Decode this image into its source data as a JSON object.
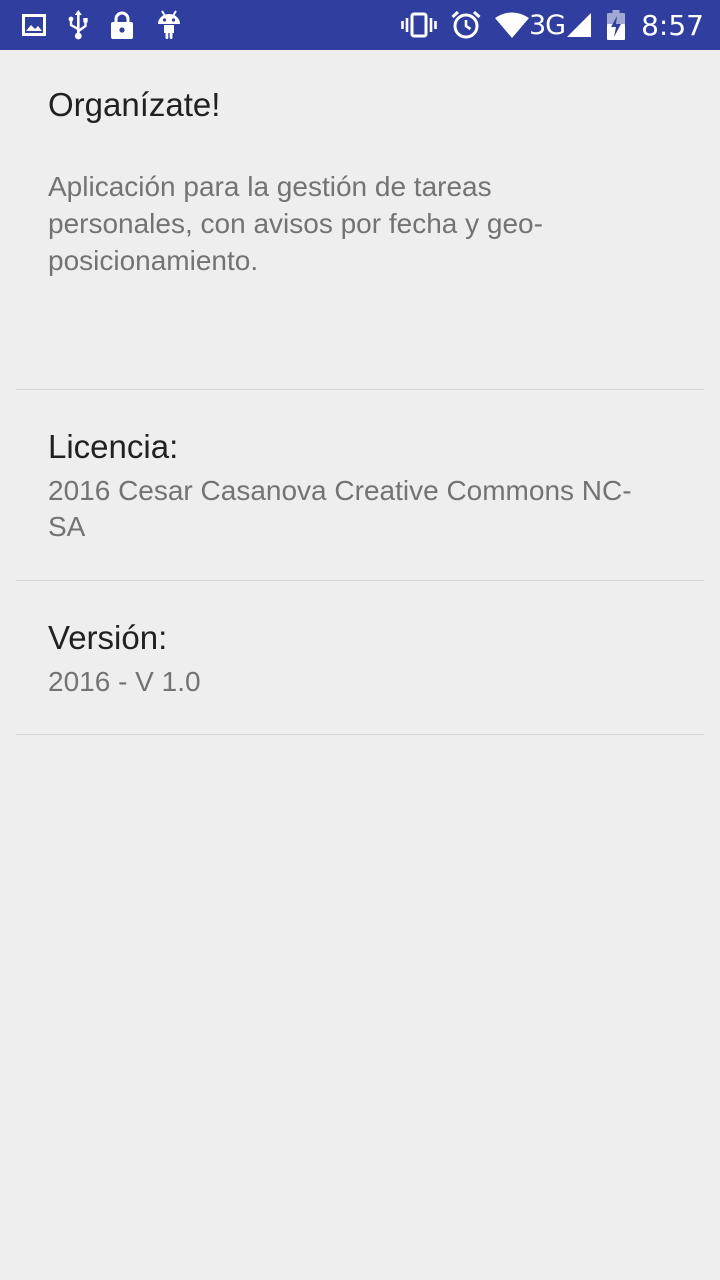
{
  "status_bar": {
    "background": "#303f9f",
    "left_icons": [
      "image-icon",
      "usb-icon",
      "lock-icon",
      "android-icon"
    ],
    "right_icons": [
      "vibrate-icon",
      "alarm-icon",
      "wifi-icon"
    ],
    "network_type": "3G",
    "time": "8:57"
  },
  "about": {
    "app_title": "Organízate!",
    "app_description": "Aplicación para la gestión de tareas personales, con avisos por fecha y geo-posicionamiento.",
    "license_label": "Licencia:",
    "license_value": "2016 Cesar Casanova Creative Commons NC-SA",
    "version_label": "Versión:",
    "version_value": "2016 - V 1.0"
  }
}
